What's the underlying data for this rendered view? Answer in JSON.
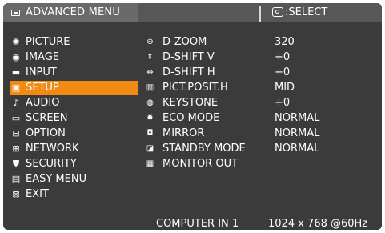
{
  "header": {
    "title": "ADVANCED MENU",
    "select_label": ":SELECT"
  },
  "menu": {
    "items": [
      {
        "label": "PICTURE",
        "icon": "picture-icon"
      },
      {
        "label": "IMAGE",
        "icon": "image-icon"
      },
      {
        "label": "INPUT",
        "icon": "input-icon"
      },
      {
        "label": "SETUP",
        "icon": "setup-icon",
        "active": true
      },
      {
        "label": "AUDIO",
        "icon": "audio-icon"
      },
      {
        "label": "SCREEN",
        "icon": "screen-icon"
      },
      {
        "label": "OPTION",
        "icon": "option-icon"
      },
      {
        "label": "NETWORK",
        "icon": "network-icon"
      },
      {
        "label": "SECURITY",
        "icon": "security-icon"
      },
      {
        "label": "EASY MENU",
        "icon": "easy-menu-icon"
      },
      {
        "label": "EXIT",
        "icon": "exit-icon"
      }
    ]
  },
  "setup": {
    "rows": [
      {
        "label": "D-ZOOM",
        "value": "320",
        "icon": "zoom-icon"
      },
      {
        "label": "D-SHIFT V",
        "value": "+0",
        "icon": "shift-v-icon"
      },
      {
        "label": "D-SHIFT H",
        "value": "+0",
        "icon": "shift-h-icon"
      },
      {
        "label": "PICT.POSIT.H",
        "value": "MID",
        "icon": "position-icon"
      },
      {
        "label": "KEYSTONE",
        "value": "+0",
        "icon": "keystone-icon"
      },
      {
        "label": "ECO MODE",
        "value": "NORMAL",
        "icon": "eco-icon"
      },
      {
        "label": "MIRROR",
        "value": "NORMAL",
        "icon": "mirror-icon"
      },
      {
        "label": "STANDBY MODE",
        "value": "NORMAL",
        "icon": "standby-icon"
      },
      {
        "label": "MONITOR OUT",
        "value": "",
        "icon": "monitor-out-icon"
      }
    ]
  },
  "footer": {
    "source": "COMPUTER IN 1",
    "resolution": "1024 x 768 @60Hz"
  },
  "colors": {
    "accent": "#f08a12",
    "panel": "#3b3b3b",
    "header": "#6a6a6a",
    "text": "#ffffff"
  }
}
